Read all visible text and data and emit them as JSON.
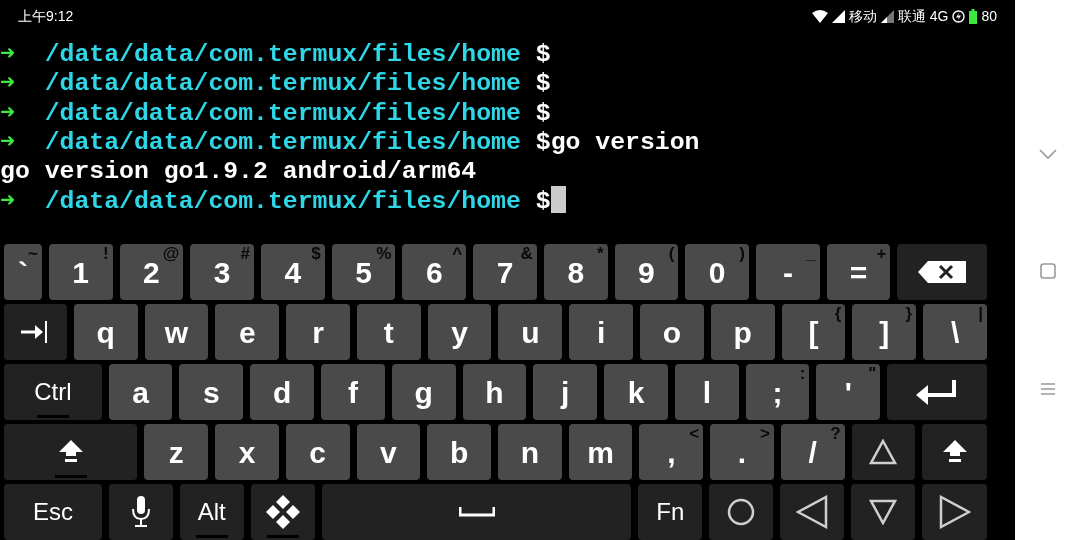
{
  "status_bar": {
    "time": "上午9:12",
    "carrier_1": "移动",
    "carrier_2": "联通",
    "network": "4G",
    "battery": "80"
  },
  "terminal": {
    "lines": [
      {
        "kind": "prompt",
        "arrow": "➜",
        "path": "/data/data/com.termux/files/home",
        "sign": "$"
      },
      {
        "kind": "prompt",
        "arrow": "➜",
        "path": "/data/data/com.termux/files/home",
        "sign": "$"
      },
      {
        "kind": "prompt",
        "arrow": "➜",
        "path": "/data/data/com.termux/files/home",
        "sign": "$"
      },
      {
        "kind": "prompt",
        "arrow": "➜",
        "path": "/data/data/com.termux/files/home",
        "sign": "$",
        "command": "go version"
      },
      {
        "kind": "output",
        "text": "go version go1.9.2 android/arm64"
      },
      {
        "kind": "prompt",
        "arrow": "➜",
        "path": "/data/data/com.termux/files/home",
        "sign": "$",
        "cursor": true
      }
    ]
  },
  "keyboard": {
    "rows": [
      {
        "keys": [
          {
            "kind": "char",
            "label": "`",
            "shifted": "~"
          },
          {
            "kind": "char",
            "label": "1",
            "shifted": "!"
          },
          {
            "kind": "char",
            "label": "2",
            "shifted": "@"
          },
          {
            "kind": "char",
            "label": "3",
            "shifted": "#"
          },
          {
            "kind": "char",
            "label": "4",
            "shifted": "$"
          },
          {
            "kind": "char",
            "label": "5",
            "shifted": "%"
          },
          {
            "kind": "char",
            "label": "6",
            "shifted": "^"
          },
          {
            "kind": "char",
            "label": "7",
            "shifted": "&"
          },
          {
            "kind": "char",
            "label": "8",
            "shifted": "*"
          },
          {
            "kind": "char",
            "label": "9",
            "shifted": "("
          },
          {
            "kind": "char",
            "label": "0",
            "shifted": ")"
          },
          {
            "kind": "char",
            "label": "-",
            "shifted": "_"
          },
          {
            "kind": "char",
            "label": "=",
            "shifted": "+"
          },
          {
            "kind": "backspace"
          }
        ]
      },
      {
        "keys": [
          {
            "kind": "tab"
          },
          {
            "kind": "char",
            "label": "q"
          },
          {
            "kind": "char",
            "label": "w"
          },
          {
            "kind": "char",
            "label": "e"
          },
          {
            "kind": "char",
            "label": "r"
          },
          {
            "kind": "char",
            "label": "t"
          },
          {
            "kind": "char",
            "label": "y"
          },
          {
            "kind": "char",
            "label": "u"
          },
          {
            "kind": "char",
            "label": "i"
          },
          {
            "kind": "char",
            "label": "o"
          },
          {
            "kind": "char",
            "label": "p"
          },
          {
            "kind": "char",
            "label": "[",
            "shifted": "{"
          },
          {
            "kind": "char",
            "label": "]",
            "shifted": "}"
          },
          {
            "kind": "char",
            "label": "\\",
            "shifted": "|"
          }
        ]
      },
      {
        "keys": [
          {
            "kind": "mod",
            "label": "Ctrl",
            "underline": true
          },
          {
            "kind": "char",
            "label": "a"
          },
          {
            "kind": "char",
            "label": "s"
          },
          {
            "kind": "char",
            "label": "d"
          },
          {
            "kind": "char",
            "label": "f"
          },
          {
            "kind": "char",
            "label": "g"
          },
          {
            "kind": "char",
            "label": "h"
          },
          {
            "kind": "char",
            "label": "j"
          },
          {
            "kind": "char",
            "label": "k"
          },
          {
            "kind": "char",
            "label": "l"
          },
          {
            "kind": "char",
            "label": ";",
            "shifted": ":"
          },
          {
            "kind": "char",
            "label": "'",
            "shifted": "\""
          },
          {
            "kind": "enter"
          }
        ]
      },
      {
        "keys": [
          {
            "kind": "shift",
            "underline": true
          },
          {
            "kind": "char",
            "label": "z"
          },
          {
            "kind": "char",
            "label": "x"
          },
          {
            "kind": "char",
            "label": "c"
          },
          {
            "kind": "char",
            "label": "v"
          },
          {
            "kind": "char",
            "label": "b"
          },
          {
            "kind": "char",
            "label": "n"
          },
          {
            "kind": "char",
            "label": "m"
          },
          {
            "kind": "char",
            "label": ",",
            "shifted": "<"
          },
          {
            "kind": "char",
            "label": ".",
            "shifted": ">"
          },
          {
            "kind": "char",
            "label": "/",
            "shifted": "?"
          },
          {
            "kind": "up"
          },
          {
            "kind": "shift",
            "underline": false
          }
        ]
      },
      {
        "keys": [
          {
            "kind": "mod",
            "label": "Esc",
            "underline": false
          },
          {
            "kind": "mic"
          },
          {
            "kind": "mod",
            "label": "Alt",
            "underline": true
          },
          {
            "kind": "dpad",
            "underline": true
          },
          {
            "kind": "space"
          },
          {
            "kind": "mod",
            "label": "Fn",
            "underline": false
          },
          {
            "kind": "home"
          },
          {
            "kind": "left"
          },
          {
            "kind": "down"
          },
          {
            "kind": "right"
          }
        ]
      }
    ]
  }
}
